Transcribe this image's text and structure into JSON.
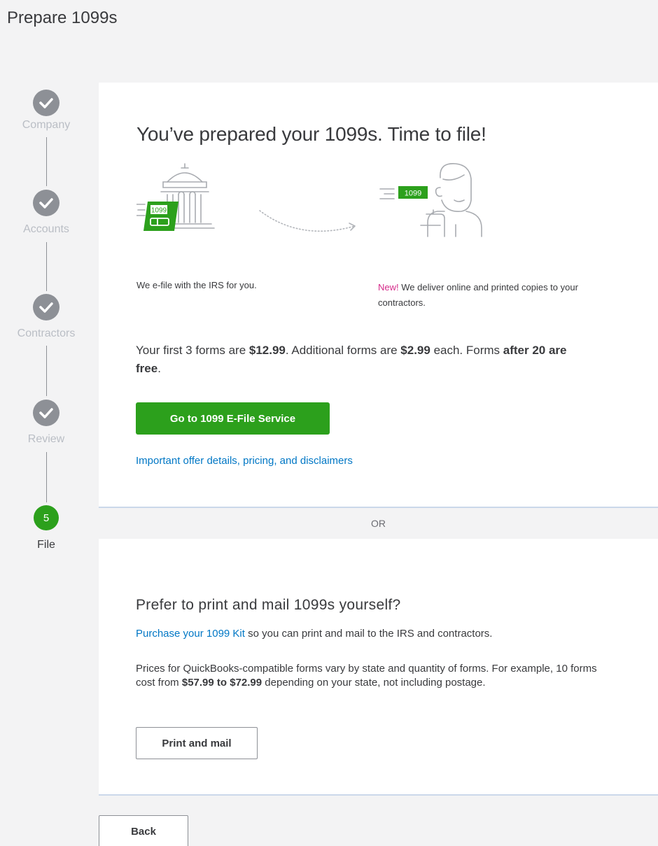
{
  "header": {
    "title": "Prepare 1099s"
  },
  "stepper": {
    "steps": [
      {
        "label": "Company",
        "state": "done"
      },
      {
        "label": "Accounts",
        "state": "done"
      },
      {
        "label": "Contractors",
        "state": "done"
      },
      {
        "label": "Review",
        "state": "done"
      },
      {
        "label": "File",
        "state": "active",
        "number": "5"
      }
    ]
  },
  "efile": {
    "heading": "You’ve prepared your 1099s. Time to file!",
    "form_badge": "1099",
    "caption_left": "We e-file with the IRS for you.",
    "caption_right_new": "New!",
    "caption_right_rest": " We deliver online and printed copies to your contractors.",
    "pricing": {
      "p1": "Your first 3 forms are ",
      "p1_price": "$12.99",
      "p2": ". Additional forms are ",
      "p2_price": "$2.99",
      "p3": " each. Forms ",
      "p3_bold": "after 20 are free",
      "p4": "."
    },
    "button_label": "Go to 1099 E-File Service",
    "details_link": "Important offer details, pricing, and disclaimers"
  },
  "divider": {
    "label": "OR"
  },
  "print": {
    "heading": "Prefer to print and mail 1099s yourself?",
    "kit_link": "Purchase your 1099 Kit",
    "kit_rest": " so you can print and mail to the IRS and contractors.",
    "prices_p1": "Prices for QuickBooks-compatible forms vary by state and quantity of forms. For example, 10 forms cost from ",
    "prices_bold": "$57.99 to $72.99",
    "prices_p2": " depending on your state, not including postage.",
    "button_label": "Print and mail"
  },
  "footer": {
    "back_label": "Back"
  },
  "colors": {
    "accent_green": "#2ca01c",
    "link_blue": "#0077c5",
    "new_pink": "#d52b8a"
  },
  "icons": [
    "check-icon",
    "bank-building-icon",
    "document-1099-icon",
    "dotted-arrow-icon",
    "contractor-person-icon"
  ]
}
